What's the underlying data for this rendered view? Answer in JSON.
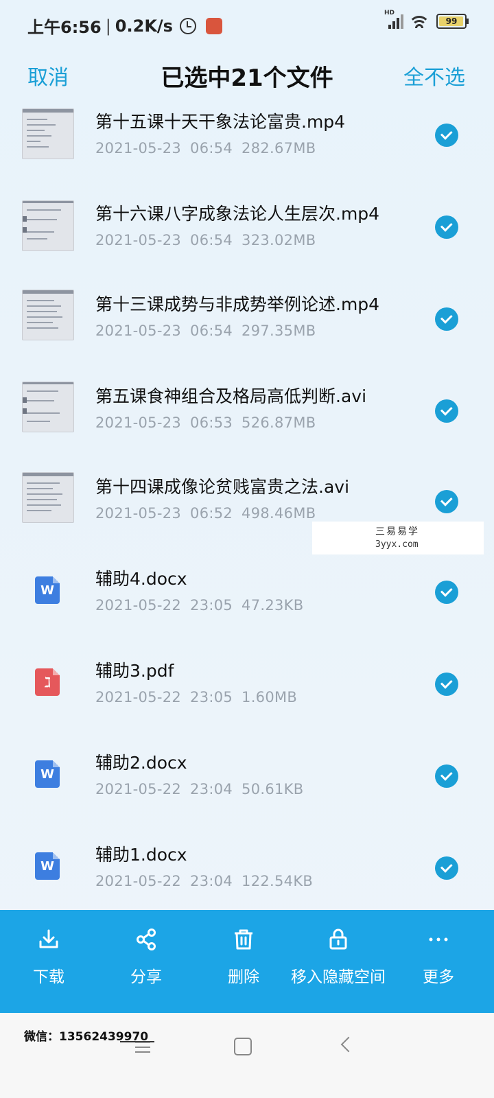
{
  "status_bar": {
    "time": "上午6:56",
    "speed": "0.2K/s",
    "network": "HD",
    "battery": "99"
  },
  "header": {
    "cancel_label": "取消",
    "title": "已选中21个文件",
    "deselect_all_label": "全不选"
  },
  "files": [
    {
      "name": "第十五课十天干象法论富贵.mp4",
      "date": "2021-05-23",
      "time": "06:54",
      "size": "282.67MB",
      "type": "video",
      "selected": true
    },
    {
      "name": "第十六课八字成象法论人生层次.mp4",
      "date": "2021-05-23",
      "time": "06:54",
      "size": "323.02MB",
      "type": "video",
      "selected": true
    },
    {
      "name": "第十三课成势与非成势举例论述.mp4",
      "date": "2021-05-23",
      "time": "06:54",
      "size": "297.35MB",
      "type": "video",
      "selected": true
    },
    {
      "name": "第五课食神组合及格局高低判断.avi",
      "date": "2021-05-23",
      "time": "06:53",
      "size": "526.87MB",
      "type": "video",
      "selected": true
    },
    {
      "name": "第十四课成像论贫贱富贵之法.avi",
      "date": "2021-05-23",
      "time": "06:52",
      "size": "498.46MB",
      "type": "video",
      "selected": true
    },
    {
      "name": "辅助4.docx",
      "date": "2021-05-22",
      "time": "23:05",
      "size": "47.23KB",
      "type": "word",
      "icon_text": "W",
      "selected": true
    },
    {
      "name": "辅助3.pdf",
      "date": "2021-05-22",
      "time": "23:05",
      "size": "1.60MB",
      "type": "pdf",
      "icon_text": "ℷ",
      "selected": true
    },
    {
      "name": "辅助2.docx",
      "date": "2021-05-22",
      "time": "23:04",
      "size": "50.61KB",
      "type": "word",
      "icon_text": "W",
      "selected": true
    },
    {
      "name": "辅助1.docx",
      "date": "2021-05-22",
      "time": "23:04",
      "size": "122.54KB",
      "type": "word",
      "icon_text": "W",
      "selected": true
    }
  ],
  "watermark": {
    "line1": "三易易学",
    "line2": "3yyx.com"
  },
  "actions": [
    {
      "label": "下载",
      "icon": "download-icon"
    },
    {
      "label": "分享",
      "icon": "share-icon"
    },
    {
      "label": "删除",
      "icon": "trash-icon"
    },
    {
      "label": "移入隐藏空间",
      "icon": "lock-icon"
    },
    {
      "label": "更多",
      "icon": "more-icon"
    }
  ],
  "footer_note": "微信：13562439970",
  "colors": {
    "accent": "#1a9fd6",
    "action_bar": "#1ca5e6",
    "word": "#3d7ee0",
    "pdf": "#e5585b"
  }
}
